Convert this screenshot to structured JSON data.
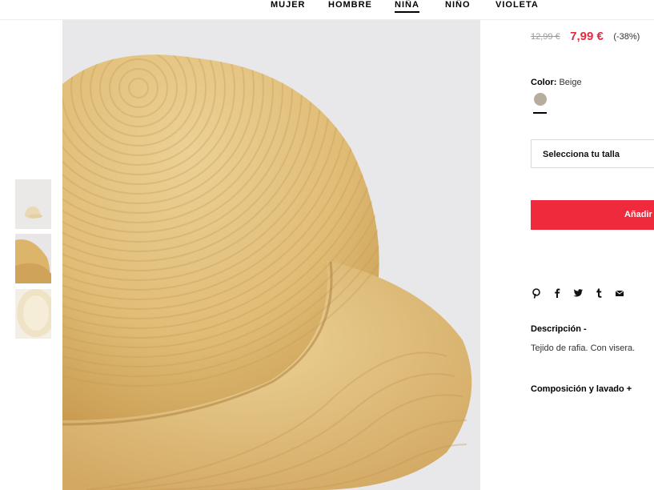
{
  "nav": {
    "items": [
      {
        "label": "MUJER"
      },
      {
        "label": "HOMBRE"
      },
      {
        "label": "NIÑA",
        "active": true
      },
      {
        "label": "NIÑO"
      },
      {
        "label": "VIOLETA"
      }
    ]
  },
  "product": {
    "old_price": "12,99 €",
    "sale_price": "7,99 €",
    "discount": "(-38%)",
    "color_label": "Color:",
    "color_value": "Beige",
    "swatch_color": "#b7ad9c",
    "size_placeholder": "Selecciona tu talla",
    "add_button_label": "Añadir",
    "description_title": "Descripción  -",
    "description_text": "Tejido de rafia. Con visera.",
    "composition_title": "Composición y lavado  +"
  },
  "share_icons": [
    "pinterest-icon",
    "facebook-icon",
    "twitter-icon",
    "tumblr-icon",
    "email-icon"
  ],
  "thumbnails": [
    {
      "name": "thumbnail-hat-front"
    },
    {
      "name": "thumbnail-hat-closeup"
    },
    {
      "name": "thumbnail-hat-inside"
    }
  ],
  "colors": {
    "accent": "#f02a3d",
    "sale_price": "#e8283f",
    "straw": "#e3c37e"
  }
}
